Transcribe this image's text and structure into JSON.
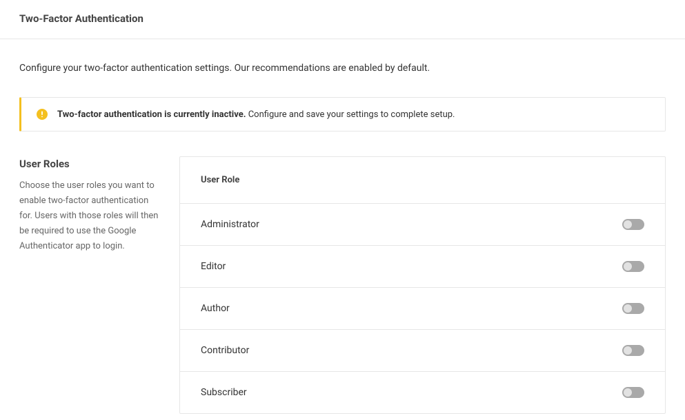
{
  "header": {
    "title": "Two-Factor Authentication"
  },
  "intro": {
    "description": "Configure your two-factor authentication settings. Our recommendations are enabled by default."
  },
  "alert": {
    "icon": "alert-icon",
    "strong": "Two-factor authentication is currently inactive.",
    "rest": " Configure and save your settings to complete setup."
  },
  "sidebar": {
    "title": "User Roles",
    "description": "Choose the user roles you want to enable two-factor authentication for. Users with those roles will then be required to use the Google Authenticator app to login."
  },
  "table": {
    "header": "User Role",
    "roles": [
      {
        "label": "Administrator",
        "enabled": false
      },
      {
        "label": "Editor",
        "enabled": false
      },
      {
        "label": "Author",
        "enabled": false
      },
      {
        "label": "Contributor",
        "enabled": false
      },
      {
        "label": "Subscriber",
        "enabled": false
      }
    ]
  },
  "colors": {
    "warn": "#f4c020",
    "border": "#e6e6e6",
    "toggle_track": "#a9a9a9",
    "toggle_knob": "#e2e2e2"
  }
}
